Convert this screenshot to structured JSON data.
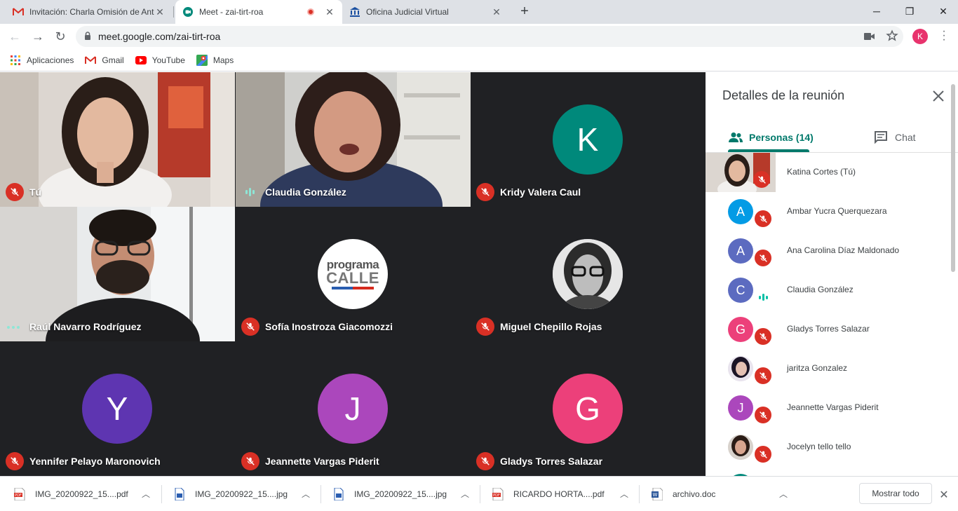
{
  "browser": {
    "tabs": [
      {
        "title": "Invitación: Charla Omisión de Ant",
        "favicon": "gmail-icon"
      },
      {
        "title": "Meet - zai-tirt-roa",
        "favicon": "meet-icon",
        "active": true,
        "recording": true
      },
      {
        "title": "Oficina Judicial Virtual",
        "favicon": "bank-icon"
      }
    ],
    "url": "meet.google.com/zai-tirt-roa",
    "profile_initial": "K",
    "bookmarks": [
      {
        "label": "Aplicaciones",
        "icon": "apps-grid-icon"
      },
      {
        "label": "Gmail",
        "icon": "gmail-icon"
      },
      {
        "label": "YouTube",
        "icon": "youtube-icon"
      },
      {
        "label": "Maps",
        "icon": "maps-icon"
      }
    ]
  },
  "meet": {
    "tiles": [
      {
        "name": "Tú",
        "state": "muted",
        "kind": "video"
      },
      {
        "name": "Claudia González",
        "state": "speaking",
        "kind": "video"
      },
      {
        "name": "Kridy Valera Caul",
        "state": "muted",
        "kind": "avatar",
        "initial": "K",
        "color": "#00897b"
      },
      {
        "name": "Raúl Navarro Rodríguez",
        "state": "idle",
        "kind": "video"
      },
      {
        "name": "Sofía Inostroza Giacomozzi",
        "state": "muted",
        "kind": "logo",
        "logo_line1": "programa",
        "logo_line2": "CALLE"
      },
      {
        "name": "Miguel Chepillo Rojas",
        "state": "muted",
        "kind": "photo"
      },
      {
        "name": "Yennifer Pelayo Maronovich",
        "state": "muted",
        "kind": "avatar",
        "initial": "Y",
        "color": "#5e35b1"
      },
      {
        "name": "Jeannette Vargas Piderit",
        "state": "muted",
        "kind": "avatar",
        "initial": "J",
        "color": "#ab47bc"
      },
      {
        "name": "Gladys Torres Salazar",
        "state": "muted",
        "kind": "avatar",
        "initial": "G",
        "color": "#ec407a"
      }
    ]
  },
  "panel": {
    "title": "Detalles de la reunión",
    "tab_people": "Personas (14)",
    "tab_chat": "Chat",
    "people": [
      {
        "name": "Katina Cortes (Tú)",
        "kind": "video",
        "state": "muted"
      },
      {
        "name": "Ambar Yucra Querquezara",
        "initial": "A",
        "color": "#039be5",
        "state": "muted"
      },
      {
        "name": "Ana Carolina Díaz Maldonado",
        "initial": "A",
        "color": "#5c6bc0",
        "state": "muted"
      },
      {
        "name": "Claudia González",
        "initial": "C",
        "color": "#5c6bc0",
        "state": "speaking"
      },
      {
        "name": "Gladys Torres Salazar",
        "initial": "G",
        "color": "#ec407a",
        "state": "muted"
      },
      {
        "name": "jaritza Gonzalez",
        "kind": "photo",
        "state": "muted"
      },
      {
        "name": "Jeannette Vargas Piderit",
        "initial": "J",
        "color": "#ab47bc",
        "state": "muted"
      },
      {
        "name": "Jocelyn tello tello",
        "kind": "photo",
        "state": "muted"
      }
    ]
  },
  "downloads": {
    "items": [
      {
        "name": "IMG_20200922_15....pdf",
        "type": "pdf"
      },
      {
        "name": "IMG_20200922_15....jpg",
        "type": "image"
      },
      {
        "name": "IMG_20200922_15....jpg",
        "type": "image"
      },
      {
        "name": "RICARDO HORTA....pdf",
        "type": "pdf"
      },
      {
        "name": "archivo.doc",
        "type": "doc"
      }
    ],
    "show_all": "Mostrar todo"
  }
}
